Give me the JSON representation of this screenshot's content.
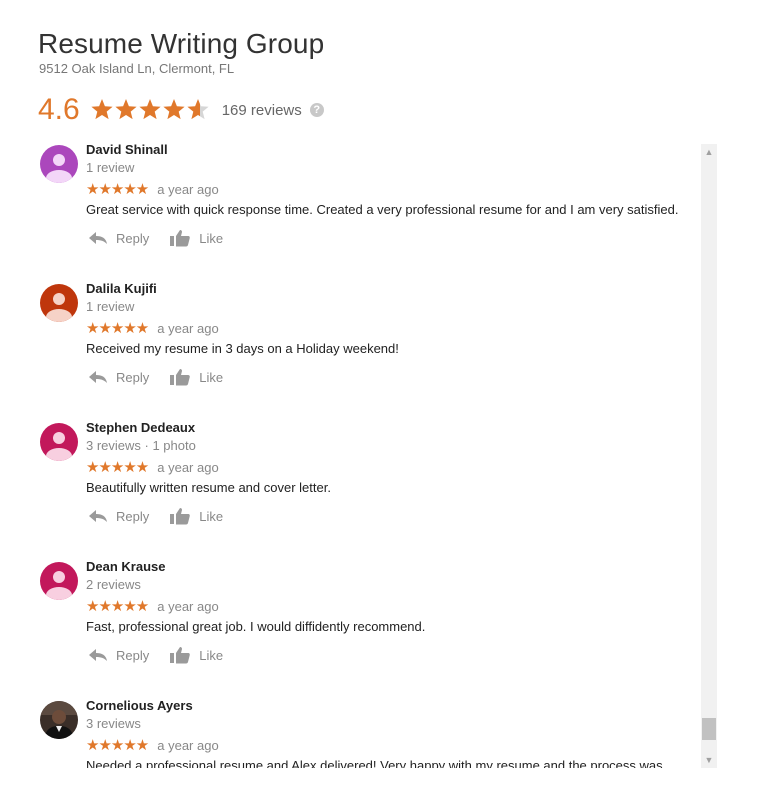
{
  "business": {
    "name": "Resume Writing Group",
    "address": "9512 Oak Island Ln, Clermont, FL",
    "rating": "4.6",
    "rating_value": 4.6,
    "review_count": "169 reviews",
    "help_icon": "?"
  },
  "colors": {
    "accent": "#e0782b",
    "muted": "#888888",
    "scroll_track": "#f1f1f1"
  },
  "actions": {
    "reply": "Reply",
    "like": "Like"
  },
  "reviews": [
    {
      "name": "David Shinall",
      "meta": "1 review",
      "stars": "★★★★★",
      "date": "a year ago",
      "text": "Great service with quick response time. Created a very professional resume for and I am very satisfied.",
      "avatar_color": "#ab47bc"
    },
    {
      "name": "Dalila Kujifi",
      "meta": "1 review",
      "stars": "★★★★★",
      "date": "a year ago",
      "text": "Received my resume in 3 days on a Holiday weekend!",
      "avatar_color": "#bf360c"
    },
    {
      "name": "Stephen Dedeaux",
      "meta": "3 reviews · 1 photo",
      "stars": "★★★★★",
      "date": "a year ago",
      "text": "Beautifully written resume and cover letter.",
      "avatar_color": "#c2185b"
    },
    {
      "name": "Dean Krause",
      "meta": "2 reviews",
      "stars": "★★★★★",
      "date": "a year ago",
      "text": "Fast, professional great job. I would diffidently recommend.",
      "avatar_color": "#c2185b"
    },
    {
      "name": "Cornelious Ayers",
      "meta": "3 reviews",
      "stars": "★★★★★",
      "date": "a year ago",
      "text": "Needed a professional resume and Alex delivered! Very happy with my resume and the process was",
      "avatar_color": "photo"
    }
  ],
  "scrollbar": {
    "position": 0.95
  }
}
